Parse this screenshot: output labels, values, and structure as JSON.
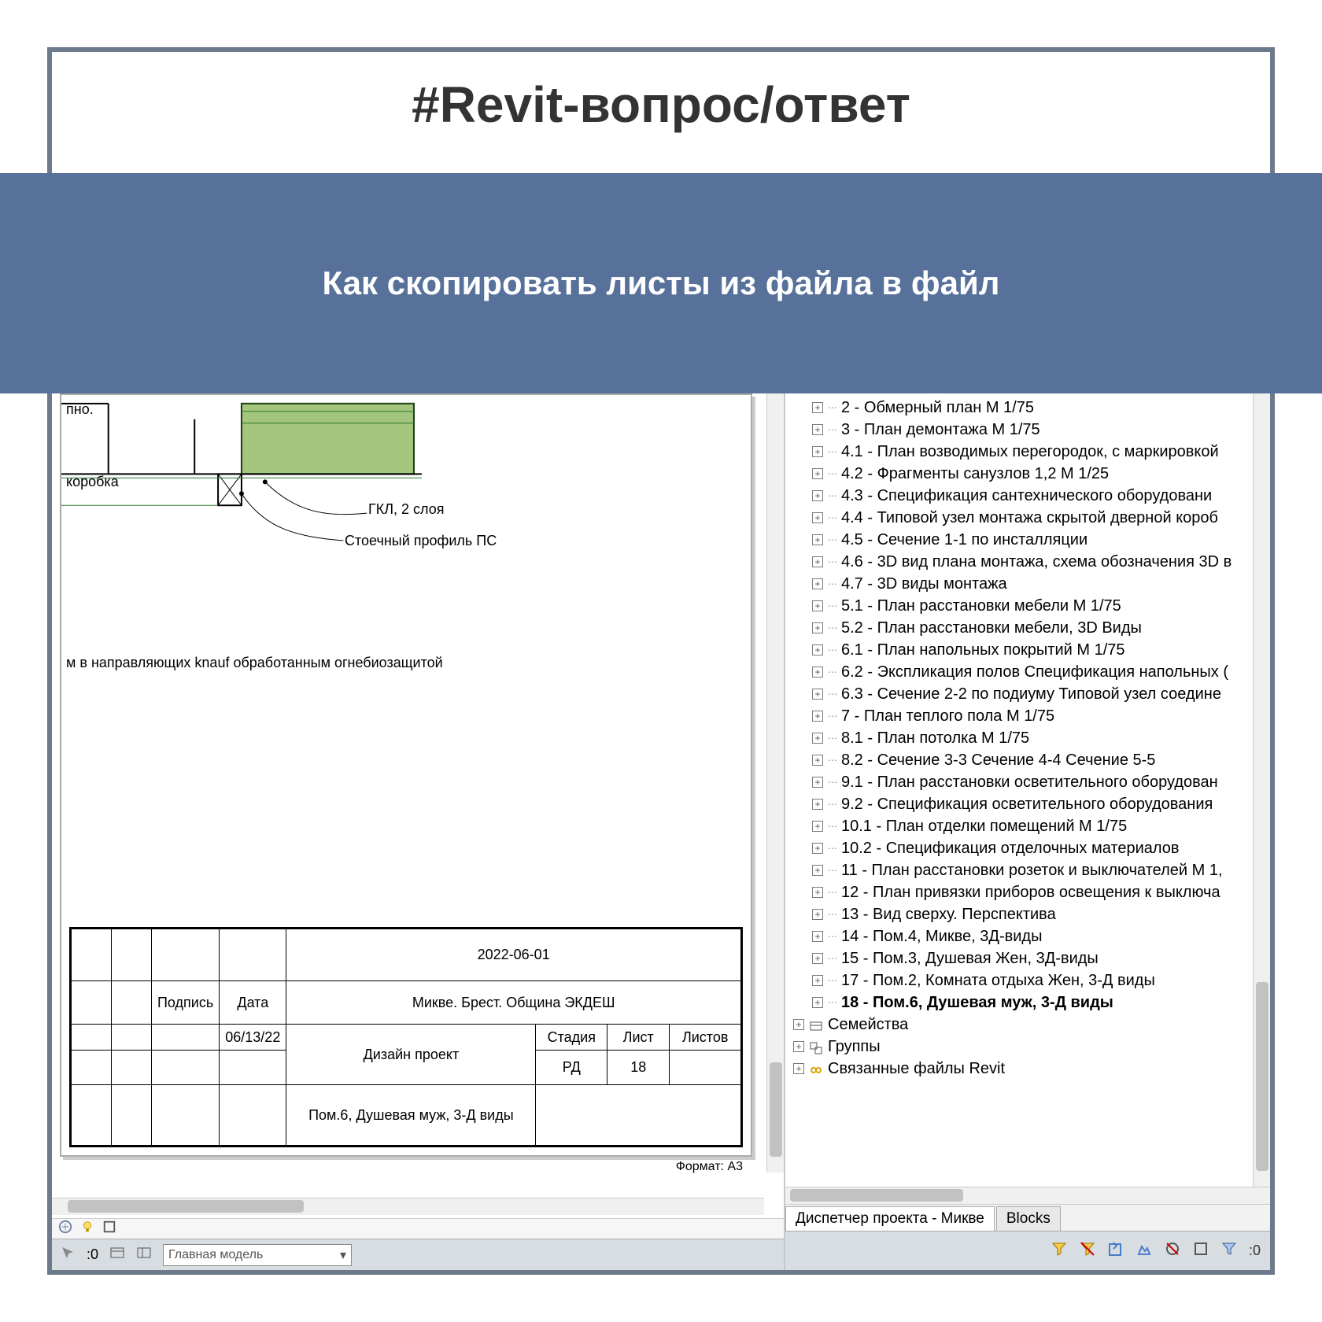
{
  "header": {
    "title": "#Revit-вопрос/ответ",
    "subtitle": "Как скопировать листы из файла в файл"
  },
  "drawing": {
    "top_label_1": "пно.",
    "top_label_2": "коробка",
    "callout_1": "ГКЛ, 2 слоя",
    "callout_2": "Стоечный профиль ПС",
    "note_line": "м в направляющих knauf обработанным огнебиозащитой"
  },
  "title_block": {
    "project_code": "2022-06-01",
    "project_name": "Микве. Брест. Община ЭКДЕШ",
    "doc_type": "Дизайн проект",
    "sheet_name": "Пом.6, Душевая муж, 3-Д виды",
    "stage_hdr": "Стадия",
    "sheet_hdr": "Лист",
    "sheets_hdr": "Листов",
    "stage": "РД",
    "sheet_no": "18",
    "sheets_total": "",
    "sig_hdr": "Подпись",
    "date_hdr": "Дата",
    "date_value": "06/13/22",
    "format": "Формат: A3"
  },
  "bottom_bar": {
    "dropdown_value": "Главная модель",
    "ratio_label": ":0"
  },
  "browser": {
    "items": [
      {
        "label": "2 - Обмерный план М 1/75"
      },
      {
        "label": "3 - План демонтажа М 1/75"
      },
      {
        "label": "4.1 - План возводимых перегородок, с маркировкой"
      },
      {
        "label": "4.2 - Фрагменты санузлов 1,2 М 1/25"
      },
      {
        "label": "4.3 - Спецификация сантехнического оборудовани"
      },
      {
        "label": "4.4 - Типовой узел монтажа скрытой дверной короб"
      },
      {
        "label": "4.5 - Сечение 1-1 по инсталляции"
      },
      {
        "label": "4.6 - 3D вид плана монтажа, схема обозначения 3D в"
      },
      {
        "label": "4.7 - 3D виды монтажа"
      },
      {
        "label": "5.1 - План расстановки мебели М 1/75"
      },
      {
        "label": "5.2 - План расстановки мебели, 3D Виды"
      },
      {
        "label": "6.1 - План напольных покрытий М 1/75"
      },
      {
        "label": "6.2 - Экспликация полов Спецификация напольных ("
      },
      {
        "label": "6.3 - Сечение 2-2 по подиуму Типовой узел соедине"
      },
      {
        "label": "7 - План теплого пола М 1/75"
      },
      {
        "label": "8.1 - План потолка М 1/75"
      },
      {
        "label": "8.2 - Сечение 3-3 Сечение 4-4 Сечение 5-5"
      },
      {
        "label": "9.1 - План расстановки осветительного оборудован"
      },
      {
        "label": "9.2 - Спецификация осветительного оборудования"
      },
      {
        "label": "10.1 - План отделки помещений М 1/75"
      },
      {
        "label": "10.2 - Спецификация отделочных материалов"
      },
      {
        "label": "11 - План расстановки розеток и выключателей М 1,"
      },
      {
        "label": "12 - План привязки приборов освещения к выключа"
      },
      {
        "label": "13 - Вид сверху. Перспектива"
      },
      {
        "label": "14 - Пом.4, Микве, 3Д-виды"
      },
      {
        "label": "15 - Пом.3, Душевая Жен, 3Д-виды"
      },
      {
        "label": "17 - Пом.2, Комната отдыха Жен, 3-Д виды"
      },
      {
        "label": "18 - Пом.6, Душевая муж, 3-Д виды",
        "bold": true
      }
    ],
    "root_nodes": [
      {
        "label": "Семейства",
        "icon": "families"
      },
      {
        "label": "Группы",
        "icon": "groups"
      },
      {
        "label": "Связанные файлы Revit",
        "icon": "links"
      }
    ],
    "tabs": [
      {
        "label": "Диспетчер проекта - Микве",
        "active": true
      },
      {
        "label": "Blocks",
        "active": false
      }
    ],
    "filter_value": ":0"
  }
}
